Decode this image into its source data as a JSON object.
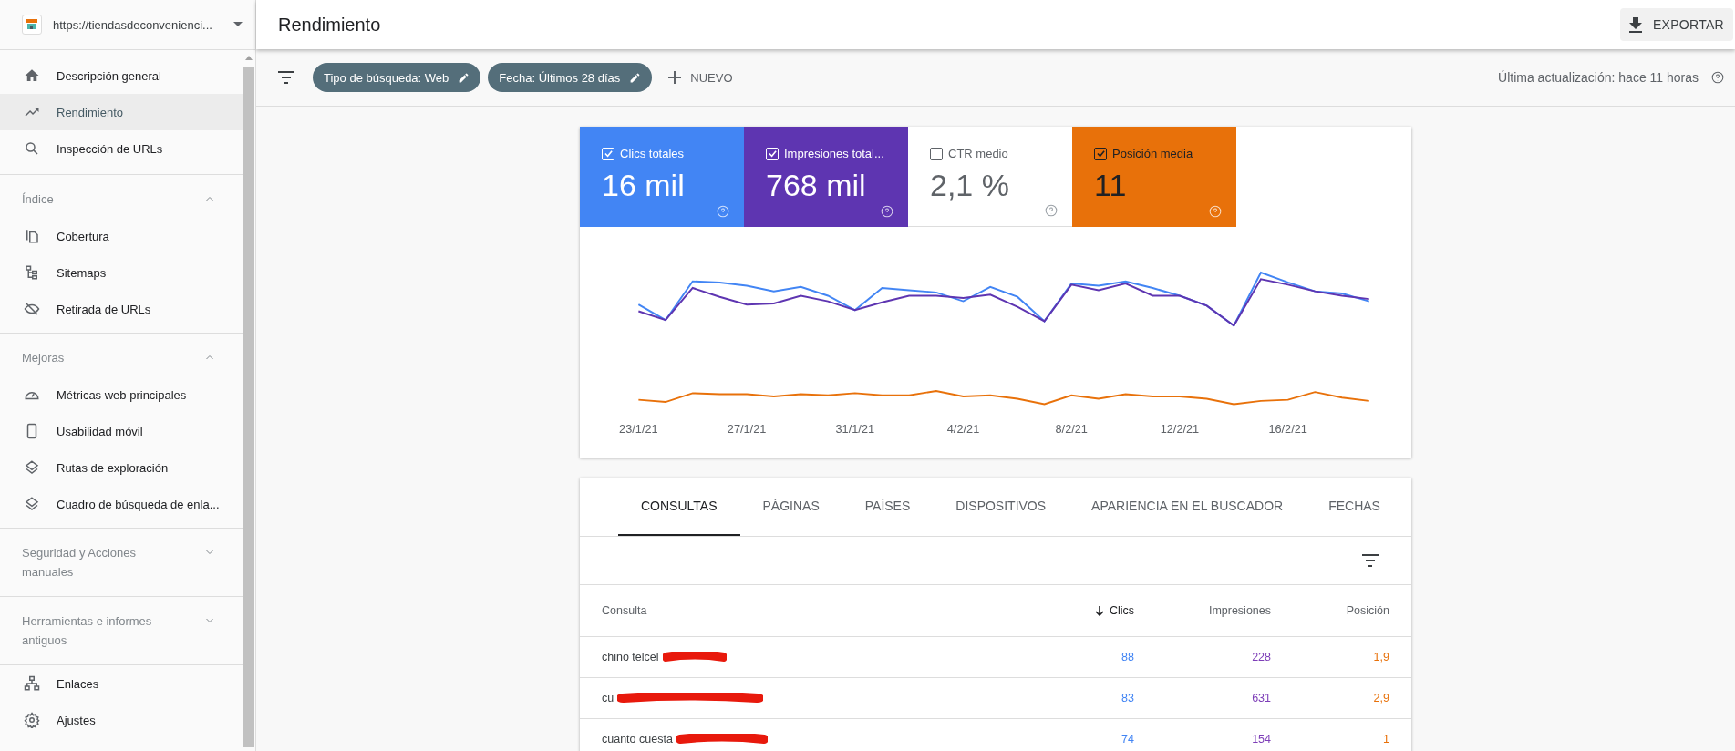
{
  "property": {
    "url": "https://tiendasdeconvenienci..."
  },
  "sidebar": {
    "sections": [
      {
        "items": [
          {
            "label": "Descripción general",
            "selected": false
          },
          {
            "label": "Rendimiento",
            "selected": true
          },
          {
            "label": "Inspección de URLs",
            "selected": false
          }
        ]
      },
      {
        "title": "Índice",
        "expanded": true,
        "items": [
          {
            "label": "Cobertura",
            "selected": false
          },
          {
            "label": "Sitemaps",
            "selected": false
          },
          {
            "label": "Retirada de URLs",
            "selected": false
          }
        ]
      },
      {
        "title": "Mejoras",
        "expanded": true,
        "items": [
          {
            "label": "Métricas web principales",
            "selected": false
          },
          {
            "label": "Usabilidad móvil",
            "selected": false
          },
          {
            "label": "Rutas de exploración",
            "selected": false
          },
          {
            "label": "Cuadro de búsqueda de enla...",
            "selected": false
          }
        ]
      },
      {
        "title": "Seguridad y Acciones manuales",
        "expanded": false
      },
      {
        "title": "Herramientas e informes antiguos",
        "expanded": false
      },
      {
        "items": [
          {
            "label": "Enlaces",
            "selected": false
          },
          {
            "label": "Ajustes",
            "selected": false
          }
        ]
      }
    ]
  },
  "header": {
    "title": "Rendimiento",
    "export": "EXPORTAR"
  },
  "filters": {
    "chips": [
      "Tipo de búsqueda: Web",
      "Fecha: Últimos 28 días"
    ],
    "new": "NUEVO",
    "updated": "Última actualización: hace 11 horas"
  },
  "metrics": [
    {
      "label": "Clics totales",
      "value": "16 mil",
      "checked": true,
      "color": "#4285f4"
    },
    {
      "label": "Impresiones total...",
      "value": "768 mil",
      "checked": true,
      "color": "#5e35b1"
    },
    {
      "label": "CTR medio",
      "value": "2,1 %",
      "checked": false
    },
    {
      "label": "Posición media",
      "value": "11",
      "checked": true,
      "color": "#e8710a"
    }
  ],
  "chart": {
    "x_labels": [
      "23/1/21",
      "27/1/21",
      "31/1/21",
      "4/2/21",
      "8/2/21",
      "12/2/21",
      "16/2/21"
    ]
  },
  "tabs": [
    {
      "label": "CONSULTAS",
      "selected": true
    },
    {
      "label": "PÁGINAS",
      "selected": false
    },
    {
      "label": "PAÍSES",
      "selected": false
    },
    {
      "label": "DISPOSITIVOS",
      "selected": false
    },
    {
      "label": "APARIENCIA EN EL BUSCADOR",
      "selected": false
    },
    {
      "label": "FECHAS",
      "selected": false
    }
  ],
  "table": {
    "columns": [
      {
        "label": "Consulta",
        "sorted": false
      },
      {
        "label": "Clics",
        "sorted": true,
        "color": "#4285f4"
      },
      {
        "label": "Impresiones",
        "sorted": false,
        "color": "#7e3fb8"
      },
      {
        "label": "Posición",
        "sorted": false,
        "color": "#e8710a"
      }
    ],
    "rows": [
      {
        "query": "chino telcel",
        "values": [
          "88",
          "228",
          "1,9"
        ]
      },
      {
        "query": "cu",
        "values": [
          "83",
          "631",
          "2,9"
        ]
      },
      {
        "query": "cuanto cuesta",
        "values": [
          "74",
          "154",
          "1"
        ]
      }
    ]
  }
}
